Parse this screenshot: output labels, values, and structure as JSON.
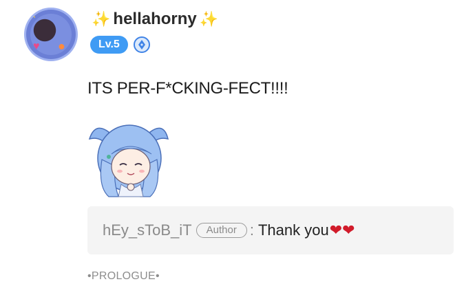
{
  "user": {
    "name": "hellahorny",
    "level": "Lv.5",
    "sparkle_left": "✨",
    "sparkle_right": "✨"
  },
  "comment": {
    "text": "ITS PER-F*CKING-FECT!!!!"
  },
  "reply": {
    "user": "hEy_sToB_iT",
    "tag": "Author",
    "separator": ":",
    "text": "Thank you",
    "hearts": "❤❤"
  },
  "topic": "•PROLOGUE•",
  "icons": {
    "title_badge": "pen-nib-icon",
    "sticker": "anime-mermaid-girl-sticker"
  },
  "colors": {
    "level_badge": "#3f9bf4",
    "title_badge_border": "#3f83e6",
    "reply_bg": "#f4f4f4",
    "heart": "#d11b2a"
  }
}
